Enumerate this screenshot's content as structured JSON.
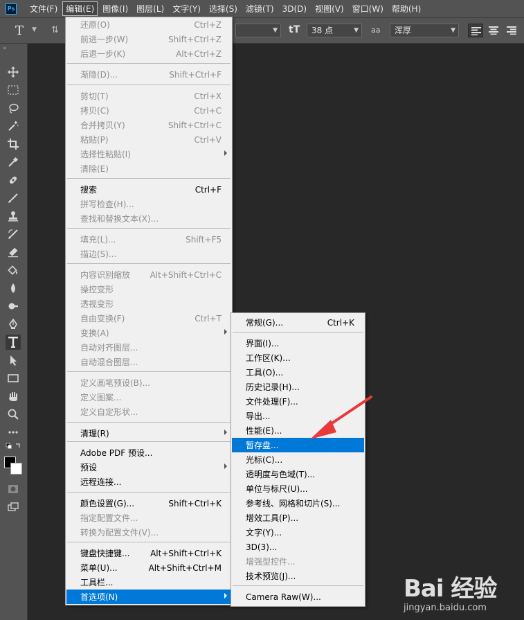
{
  "app": {
    "logo": "Ps"
  },
  "menubar": {
    "items": [
      "文件(F)",
      "编辑(E)",
      "图像(I)",
      "图层(L)",
      "文字(Y)",
      "选择(S)",
      "滤镜(T)",
      "3D(D)",
      "视图(V)",
      "窗口(W)",
      "帮助(H)"
    ],
    "active_index": 1
  },
  "options_bar": {
    "tool_icon": "T",
    "font_size": "38 点",
    "anti_alias_icon": "aa",
    "anti_alias": "浑厚",
    "size_icon": "tT"
  },
  "edit_menu": {
    "items": [
      {
        "label": "还原(O)",
        "shortcut": "Ctrl+Z",
        "disabled": true
      },
      {
        "label": "前进一步(W)",
        "shortcut": "Shift+Ctrl+Z",
        "disabled": true
      },
      {
        "label": "后退一步(K)",
        "shortcut": "Alt+Ctrl+Z",
        "disabled": true
      },
      {
        "label": "渐隐(D)...",
        "shortcut": "Shift+Ctrl+F",
        "disabled": true
      },
      {
        "label": "剪切(T)",
        "shortcut": "Ctrl+X",
        "disabled": true
      },
      {
        "label": "拷贝(C)",
        "shortcut": "Ctrl+C",
        "disabled": true
      },
      {
        "label": "合并拷贝(Y)",
        "shortcut": "Shift+Ctrl+C",
        "disabled": true
      },
      {
        "label": "粘贴(P)",
        "shortcut": "Ctrl+V",
        "disabled": true
      },
      {
        "label": "选择性粘贴(I)",
        "shortcut": "",
        "disabled": true,
        "submenu": true
      },
      {
        "label": "清除(E)",
        "shortcut": "",
        "disabled": true
      },
      {
        "label": "搜索",
        "shortcut": "Ctrl+F",
        "disabled": false
      },
      {
        "label": "拼写检查(H)...",
        "shortcut": "",
        "disabled": true
      },
      {
        "label": "查找和替换文本(X)...",
        "shortcut": "",
        "disabled": true
      },
      {
        "label": "填充(L)...",
        "shortcut": "Shift+F5",
        "disabled": true
      },
      {
        "label": "描边(S)...",
        "shortcut": "",
        "disabled": true
      },
      {
        "label": "内容识别缩放",
        "shortcut": "Alt+Shift+Ctrl+C",
        "disabled": true
      },
      {
        "label": "操控变形",
        "shortcut": "",
        "disabled": true
      },
      {
        "label": "透视变形",
        "shortcut": "",
        "disabled": true
      },
      {
        "label": "自由变换(F)",
        "shortcut": "Ctrl+T",
        "disabled": true
      },
      {
        "label": "变换(A)",
        "shortcut": "",
        "disabled": true,
        "submenu": true
      },
      {
        "label": "自动对齐图层...",
        "shortcut": "",
        "disabled": true
      },
      {
        "label": "自动混合图层...",
        "shortcut": "",
        "disabled": true
      },
      {
        "label": "定义画笔预设(B)...",
        "shortcut": "",
        "disabled": true
      },
      {
        "label": "定义图案...",
        "shortcut": "",
        "disabled": true
      },
      {
        "label": "定义自定形状...",
        "shortcut": "",
        "disabled": true
      },
      {
        "label": "清理(R)",
        "shortcut": "",
        "disabled": false,
        "submenu": true
      },
      {
        "label": "Adobe PDF 预设...",
        "shortcut": "",
        "disabled": false
      },
      {
        "label": "预设",
        "shortcut": "",
        "disabled": false,
        "submenu": true
      },
      {
        "label": "远程连接...",
        "shortcut": "",
        "disabled": false
      },
      {
        "label": "颜色设置(G)...",
        "shortcut": "Shift+Ctrl+K",
        "disabled": false
      },
      {
        "label": "指定配置文件...",
        "shortcut": "",
        "disabled": true
      },
      {
        "label": "转换为配置文件(V)...",
        "shortcut": "",
        "disabled": true
      },
      {
        "label": "键盘快捷键...",
        "shortcut": "Alt+Shift+Ctrl+K",
        "disabled": false
      },
      {
        "label": "菜单(U)...",
        "shortcut": "Alt+Shift+Ctrl+M",
        "disabled": false
      },
      {
        "label": "工具栏...",
        "shortcut": "",
        "disabled": false
      },
      {
        "label": "首选项(N)",
        "shortcut": "",
        "disabled": false,
        "submenu": true,
        "highlighted": true
      }
    ]
  },
  "prefs_menu": {
    "items": [
      {
        "label": "常规(G)...",
        "shortcut": "Ctrl+K",
        "disabled": false
      },
      {
        "label": "界面(I)...",
        "shortcut": "",
        "disabled": false
      },
      {
        "label": "工作区(K)...",
        "shortcut": "",
        "disabled": false
      },
      {
        "label": "工具(O)...",
        "shortcut": "",
        "disabled": false
      },
      {
        "label": "历史记录(H)...",
        "shortcut": "",
        "disabled": false
      },
      {
        "label": "文件处理(F)...",
        "shortcut": "",
        "disabled": false
      },
      {
        "label": "导出...",
        "shortcut": "",
        "disabled": false
      },
      {
        "label": "性能(E)...",
        "shortcut": "",
        "disabled": false
      },
      {
        "label": "暂存盘...",
        "shortcut": "",
        "disabled": false,
        "highlighted": true
      },
      {
        "label": "光标(C)...",
        "shortcut": "",
        "disabled": false
      },
      {
        "label": "透明度与色域(T)...",
        "shortcut": "",
        "disabled": false
      },
      {
        "label": "单位与标尺(U)...",
        "shortcut": "",
        "disabled": false
      },
      {
        "label": "参考线、网格和切片(S)...",
        "shortcut": "",
        "disabled": false
      },
      {
        "label": "增效工具(P)...",
        "shortcut": "",
        "disabled": false
      },
      {
        "label": "文字(Y)...",
        "shortcut": "",
        "disabled": false
      },
      {
        "label": "3D(3)...",
        "shortcut": "",
        "disabled": false
      },
      {
        "label": "增强型控件...",
        "shortcut": "",
        "disabled": true
      },
      {
        "label": "技术预览(J)...",
        "shortcut": "",
        "disabled": false
      },
      {
        "label": "Camera Raw(W)...",
        "shortcut": "",
        "disabled": false
      }
    ]
  },
  "watermark": {
    "text": "Bai 经验",
    "url": "jingyan.baidu.com"
  },
  "colors": {
    "highlight": "#0078d7",
    "arrow": "#e8393b",
    "chrome": "#535353",
    "canvas": "#282828"
  }
}
